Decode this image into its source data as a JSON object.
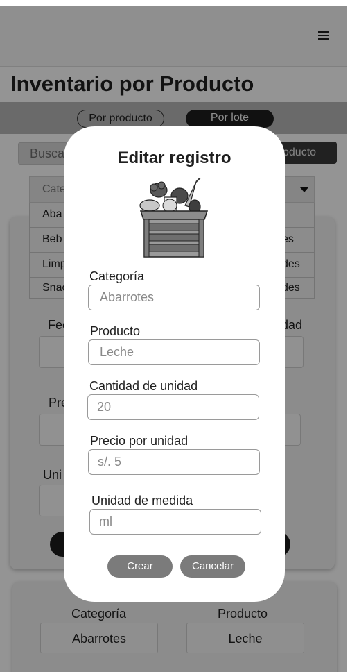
{
  "page": {
    "title": "Inventario por Producto",
    "tabs": [
      "Por producto",
      "Por lote"
    ],
    "search_placeholder": "Busca",
    "add_button_label": "oducto",
    "category_select_value": "Cate",
    "dropdown_items": [
      {
        "left": "Aba",
        "right": ""
      },
      {
        "left": "Beb",
        "right": "es"
      },
      {
        "left": "Limp",
        "right": "des"
      },
      {
        "left": "Snac",
        "right": "des"
      }
    ],
    "card_labels": {
      "fecha": "Fec",
      "cantidad": "dad",
      "precio": "Pre",
      "unidad": "Uni"
    },
    "summary": {
      "category_label": "Categoría",
      "category_value": "Abarrotes",
      "product_label": "Producto",
      "product_value": "Leche"
    }
  },
  "modal": {
    "title": "Editar registro",
    "illustration_icon": "vegetable-crate-icon",
    "fields": [
      {
        "label": "Categoría",
        "value": "Abarrotes"
      },
      {
        "label": "Producto",
        "value": "Leche"
      },
      {
        "label": "Cantidad de unidad",
        "value": "20"
      },
      {
        "label": "Precio por unidad",
        "value": "s/. 5"
      },
      {
        "label": "Unidad de medida",
        "value": "ml"
      }
    ],
    "create_label": "Crear",
    "cancel_label": "Cancelar"
  },
  "colors": {
    "overlay": "#000000",
    "button_gray": "#7b7b7b",
    "dark": "#1c1c1c"
  }
}
